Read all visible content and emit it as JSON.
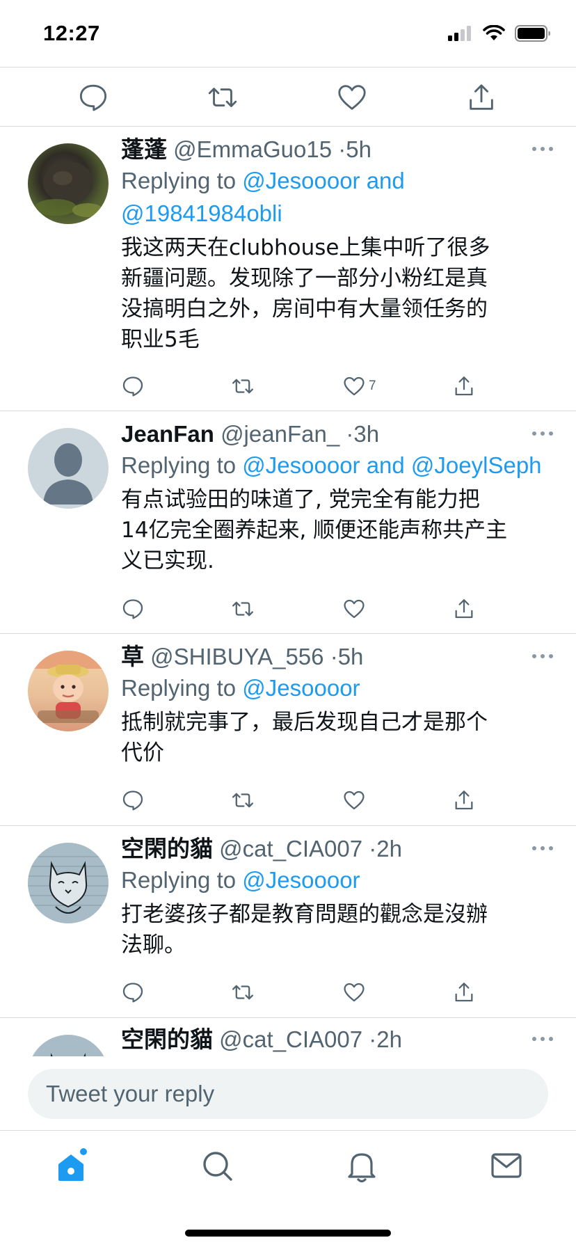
{
  "status_bar": {
    "time": "12:27"
  },
  "top_actions": [
    "reply-icon",
    "retweet-icon",
    "like-icon",
    "share-icon"
  ],
  "replies": [
    {
      "name": "蓬蓬",
      "handle": "@EmmaGuo15",
      "time": "5h",
      "replying_prefix": "Replying to",
      "replying_line1": "@Jesoooor and",
      "replying_line2": "@19841984obli",
      "content": [
        "我这两天在clubhouse上集中听了很多",
        "新疆问题。发现除了一部分小粉红是真",
        "没搞明白之外，房间中有大量领任务的",
        "职业5毛"
      ],
      "like_count": "7"
    },
    {
      "name": "JeanFan",
      "handle": "@jeanFan_",
      "time": "3h",
      "replying_prefix": "Replying to",
      "replying_line1": "@Jesoooor and @JoeylSeph",
      "content": [
        "有点试验田的味道了, 党完全有能力把",
        "14亿完全圈养起来, 顺便还能声称共产主",
        "义已实现."
      ],
      "like_count": ""
    },
    {
      "name": "草",
      "handle": "@SHIBUYA_556",
      "time": "5h",
      "replying_prefix": "Replying to",
      "replying_line1": "@Jesoooor",
      "content": [
        "抵制就完事了，最后发现自己才是那个",
        "代价"
      ],
      "like_count": ""
    },
    {
      "name": "空閑的貓",
      "handle": "@cat_CIA007",
      "time": "2h",
      "replying_prefix": "Replying to",
      "replying_line1": "@Jesoooor",
      "content": [
        "打老婆孩子都是教育問題的觀念是沒辦",
        "法聊。"
      ],
      "like_count": ""
    },
    {
      "name": "空閑的貓",
      "handle": "@cat_CIA007",
      "time": "2h"
    }
  ],
  "composer": {
    "placeholder": "Tweet your reply"
  },
  "tab_bar": [
    "home-icon",
    "search-icon",
    "notifications-icon",
    "messages-icon"
  ],
  "colors": {
    "accent": "#1d9bf0",
    "secondary_text": "#536471",
    "divider": "#d6dbe0"
  }
}
